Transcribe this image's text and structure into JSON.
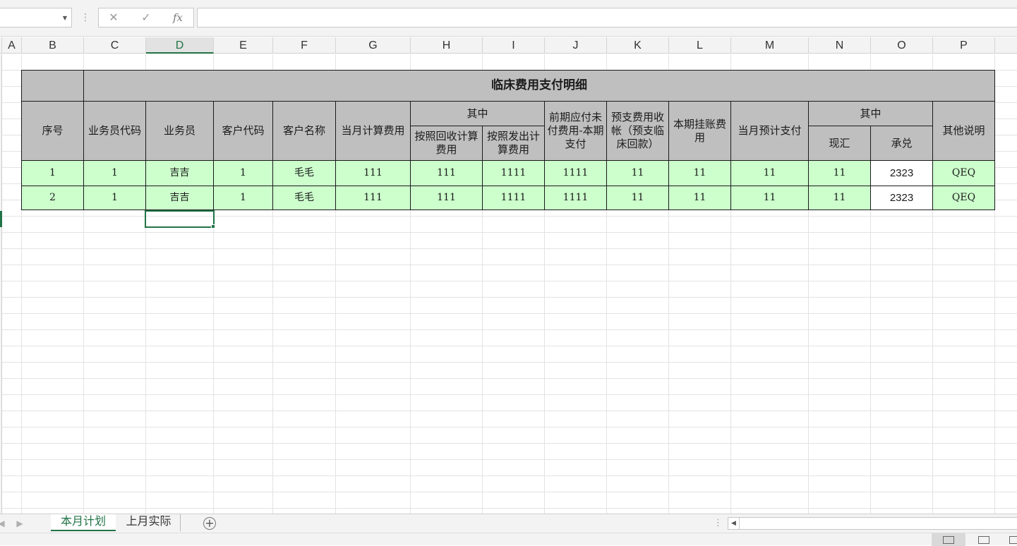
{
  "formula_bar": {
    "name_box": "",
    "cancel_icon": "✕",
    "enter_icon": "✓",
    "function_icon": "fx",
    "formula": ""
  },
  "columns": [
    "A",
    "B",
    "C",
    "D",
    "E",
    "F",
    "G",
    "H",
    "I",
    "J",
    "K",
    "L",
    "M",
    "N",
    "O",
    "P"
  ],
  "selected_column": "D",
  "table": {
    "title": "临床费用支付明细",
    "headers": {
      "seq": "序号",
      "sales_code": "业务员代码",
      "salesperson": "业务员",
      "customer_code": "客户代码",
      "customer_name": "客户名称",
      "month_calc_fee": "当月计算费用",
      "of_which_1": "其中",
      "by_collection": "按照回收计算费用",
      "by_shipment": "按照发出计算费用",
      "prior_unpaid": "前期应付未付费用-本期支付",
      "prepaid": "预支费用收帐（预支临床回款）",
      "period_suspense": "本期挂账费用",
      "month_est_pay": "当月预计支付",
      "of_which_2": "其中",
      "remit": "现汇",
      "acceptance": "承兑",
      "other_notes": "其他说明"
    },
    "rows": [
      {
        "seq": "1",
        "sales_code": "1",
        "salesperson": "吉吉",
        "customer_code": "1",
        "customer_name": "毛毛",
        "month_calc_fee": "111",
        "by_collection": "111",
        "by_shipment": "1111",
        "prior_unpaid": "1111",
        "prepaid": "11",
        "period_suspense": "11",
        "month_est_pay": "11",
        "remit": "11",
        "acceptance": "2323",
        "other_notes": "QEQ"
      },
      {
        "seq": "2",
        "sales_code": "1",
        "salesperson": "吉吉",
        "customer_code": "1",
        "customer_name": "毛毛",
        "month_calc_fee": "111",
        "by_collection": "111",
        "by_shipment": "1111",
        "prior_unpaid": "1111",
        "prepaid": "11",
        "period_suspense": "11",
        "month_est_pay": "11",
        "remit": "11",
        "acceptance": "2323",
        "other_notes": "QEQ"
      }
    ]
  },
  "sheet_tabs": [
    {
      "label": "本月计划",
      "active": true
    },
    {
      "label": "上月实际",
      "active": false
    }
  ],
  "add_sheet_icon": "+",
  "colors": {
    "accent": "#217346",
    "header_fill": "#bfbfbf",
    "data_fill": "#ccffcc"
  }
}
